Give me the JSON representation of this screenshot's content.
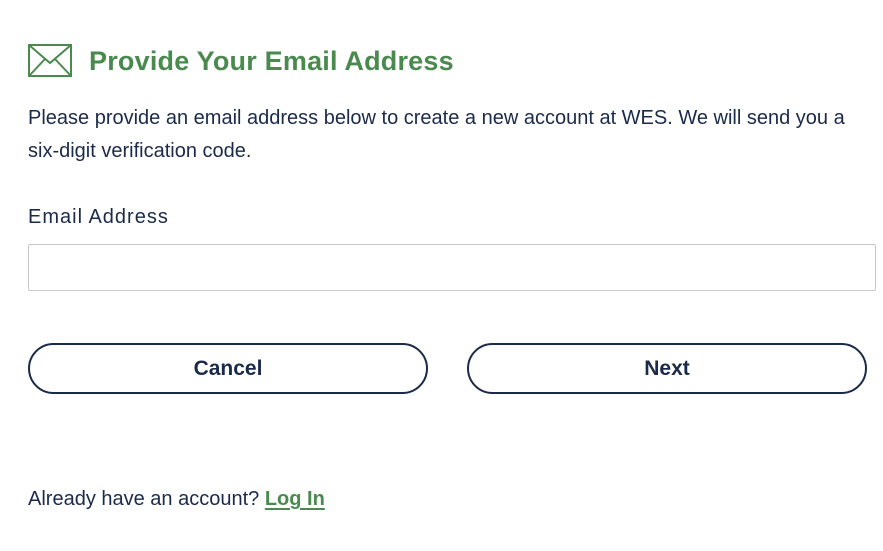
{
  "header": {
    "icon": "envelope-icon",
    "title": "Provide Your Email Address"
  },
  "intro_text": "Please provide an email address below to create a new account at WES. We will send you a six-digit verification code.",
  "email_field": {
    "label": "Email Address",
    "value": "",
    "placeholder": ""
  },
  "buttons": {
    "cancel_label": "Cancel",
    "next_label": "Next"
  },
  "footer": {
    "prompt": "Already have an account? ",
    "login_label": "Log In"
  },
  "colors": {
    "accent_green": "#4a8a4f",
    "text_navy": "#1b2a4a",
    "input_border": "#c8c8c8"
  }
}
